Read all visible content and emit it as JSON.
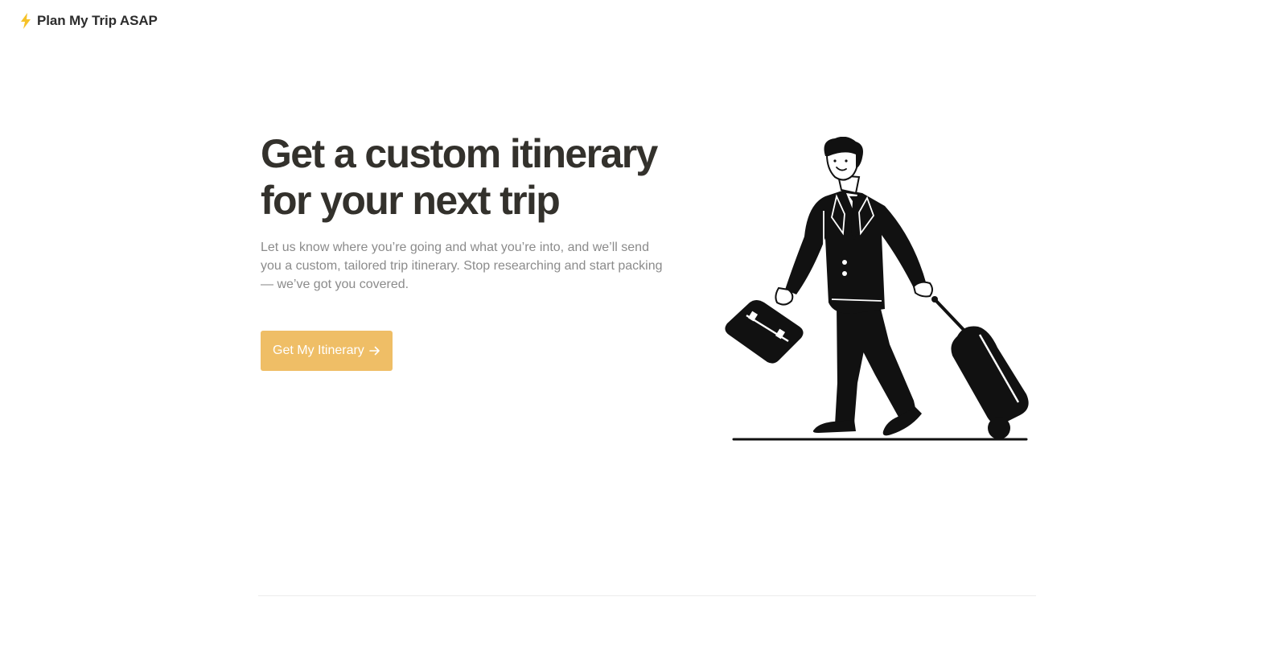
{
  "brand": {
    "icon": "lightning-bolt-icon",
    "name": "Plan My Trip ASAP"
  },
  "hero": {
    "title_line1": "Get a custom itinerary",
    "title_line2": "for your next trip",
    "description": "Let us know where you’re going and what you’re into, and we’ll send you a custom, tailored trip itinerary. Stop researching and start packing — we’ve got you covered.",
    "cta_label": "Get My Itinerary",
    "cta_icon": "arrow-right-icon"
  },
  "illustration": {
    "icon": "traveler-with-luggage-illustration"
  },
  "colors": {
    "accent": "#efbe66",
    "bolt": "#f6c229",
    "heading": "#33312c",
    "body_text": "#8b8b8b"
  }
}
